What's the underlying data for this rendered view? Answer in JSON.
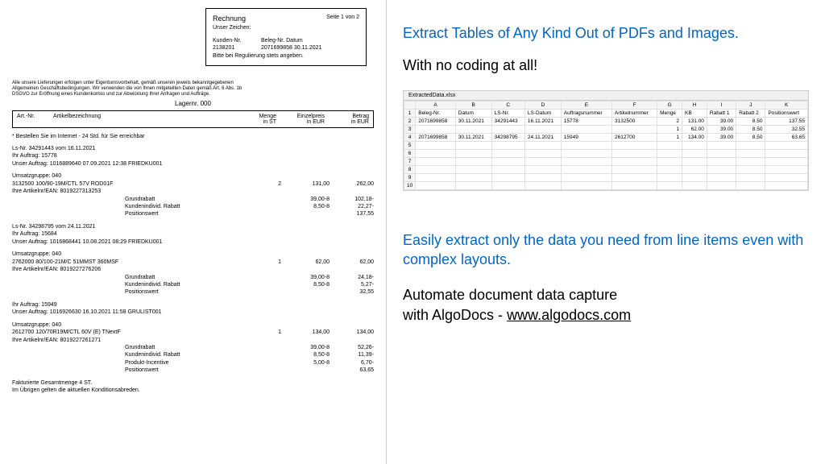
{
  "invoice": {
    "title": "Rechnung",
    "page": "Seite 1 von 2",
    "unser_zeichen_label": "Unser Zeichen:",
    "kunden_label": "Kunden-Nr.",
    "kunden_nr": "2138201",
    "beleg_label": "Beleg-Nr. Datum",
    "beleg_nr": "2071699858 30.11.2021",
    "regulierung": "Bitte bei Regulierung stets angeben.",
    "legal": "Alle unsere Lieferungen erfolgen unter Eigentumsvorbehalt, gemäß unseren jeweils bekanntgegebenen Allgemeinen Geschäftsbedingungen. Wir verwenden die von Ihnen mitgeteilten Daten gemäß Art. 6 Abs. 1b DSGVO zur Eröffnung eines Kundenkontos und zur Abwicklung Ihrer Anfragen und Aufträge.",
    "lager": "Lagernr. 000"
  },
  "th": {
    "art": "Art.-Nr.",
    "bez": "Artikelbezeichnung",
    "menge": "Menge",
    "menge_unit": "in ST",
    "preis": "Einzelpreis",
    "preis_unit": "in EUR",
    "betrag": "Betrag",
    "betrag_unit": "in EUR"
  },
  "notice": "* Bestellen Sie im Internet - 24 Std. für Sie erreichbar",
  "g1": {
    "ls": "Ls-Nr. 34291443 vom 16.11.2021",
    "auftrag": "Ihr Auftrag: 15778",
    "unser": "Unser Auftrag: 1016889640 07.09.2021 12:38 FRIEDKU001",
    "umsatz": "Umsatzgruppe: 040",
    "art": "3132500 100/90-19M/CTL 57V ROD01F",
    "ean": "Ihre Artikelnr/EAN: 8019227313253",
    "menge": "2",
    "preis": "131,00",
    "betrag": "262,00",
    "grund_l": "Grundrabatt",
    "grund_p": "39,00-8",
    "grund_b": "102,18-",
    "kind_l": "Kundenindivid. Rabatt",
    "kind_p": "8,50-8",
    "kind_b": "22,27-",
    "pos_l": "Positionswert",
    "pos_b": "137,55"
  },
  "g2": {
    "ls": "Ls-Nr. 34298795 vom 24.11.2021",
    "auftrag": "Ihr Auftrag: 15684",
    "unser": "Unser Auftrag: 1016868441 10.08.2021 08:29 FRIEDKU001",
    "umsatz": "Umsatzgruppe: 040",
    "art": "2762000 80/100-21M/C 51MMST 360MSF",
    "ean": "Ihre Artikelnr/EAN: 8019227276206",
    "menge": "1",
    "preis": "62,00",
    "betrag": "62,00",
    "grund_l": "Grundrabatt",
    "grund_p": "39,00-8",
    "grund_b": "24,18-",
    "kind_l": "Kundenindivid. Rabatt",
    "kind_p": "8,50-8",
    "kind_b": "5,27-",
    "pos_l": "Positionswert",
    "pos_b": "32,55"
  },
  "g3": {
    "auftrag": "Ihr Auftrag:   15949",
    "unser": " Unser Auftrag: 1016926630 16.10.2021 11:58 GRULIST001",
    "umsatz": "Umsatzgruppe: 040",
    "art": "2612700 120/70R19M/CTL 60V (E) TNextF",
    "ean": "Ihre Artikelnr/EAN: 8019227261271",
    "menge": "1",
    "preis": "134,00",
    "betrag": "134,00",
    "grund_l": "Grundrabatt",
    "grund_p": "39,00-8",
    "grund_b": "52,26-",
    "kind_l": "Kundenindivid. Rabatt",
    "kind_p": "8,50-8",
    "kind_b": "11,39-",
    "prod_l": "Produkt-Incentive",
    "prod_p": "5,00-8",
    "prod_b": "6,70-",
    "pos_l": "Positionswert",
    "pos_b": "63,65"
  },
  "footer": {
    "fakt": "Fakturierte Gesamtmenge        4   ST.",
    "kond": "  Im Übrigen gelten die aktuellen Konditionsabreden."
  },
  "marketing": {
    "h1": "Extract Tables of Any Kind Out of PDFs and Images.",
    "h2": "With no coding at all!",
    "h3": "Easily extract only the data you need from line items even with complex layouts.",
    "h4a": "Automate document data capture",
    "h4b": "with AlgoDocs - ",
    "url": "www.algodocs.com"
  },
  "excel": {
    "tab": "ExtractedData.xlsx",
    "cols": [
      "",
      "A",
      "B",
      "C",
      "D",
      "E",
      "F",
      "G",
      "H",
      "I",
      "J",
      "K"
    ],
    "header_row": [
      "1",
      "Beleg-Nr.",
      "Datum",
      "LS-Nr.",
      "LS-Datum",
      "Auftragsnummer",
      "Artikelnummer",
      "Menge",
      "KB",
      "Rabatt 1",
      "Rabatt 2",
      "Positionswert"
    ],
    "rows": [
      [
        "2",
        "2071699858",
        "30.11.2021",
        "34291443",
        "16.11.2021",
        "15778",
        "3132500",
        "2",
        "131.00",
        "39.00",
        "8.50",
        "137.55"
      ],
      [
        "3",
        "",
        "",
        "",
        "",
        "",
        "",
        "1",
        "62.00",
        "39.00",
        "8.50",
        "32.55"
      ],
      [
        "4",
        "2071699858",
        "30.11.2021",
        "34298795",
        "24.11.2021",
        "15949",
        "2612700",
        "1",
        "134.00",
        "39.00",
        "8.50",
        "63.65"
      ],
      [
        "5",
        "",
        "",
        "",
        "",
        "",
        "",
        "",
        "",
        "",
        "",
        ""
      ],
      [
        "6",
        "",
        "",
        "",
        "",
        "",
        "",
        "",
        "",
        "",
        "",
        ""
      ],
      [
        "7",
        "",
        "",
        "",
        "",
        "",
        "",
        "",
        "",
        "",
        "",
        ""
      ],
      [
        "8",
        "",
        "",
        "",
        "",
        "",
        "",
        "",
        "",
        "",
        "",
        ""
      ],
      [
        "9",
        "",
        "",
        "",
        "",
        "",
        "",
        "",
        "",
        "",
        "",
        ""
      ],
      [
        "10",
        "",
        "",
        "",
        "",
        "",
        "",
        "",
        "",
        "",
        "",
        ""
      ]
    ]
  }
}
